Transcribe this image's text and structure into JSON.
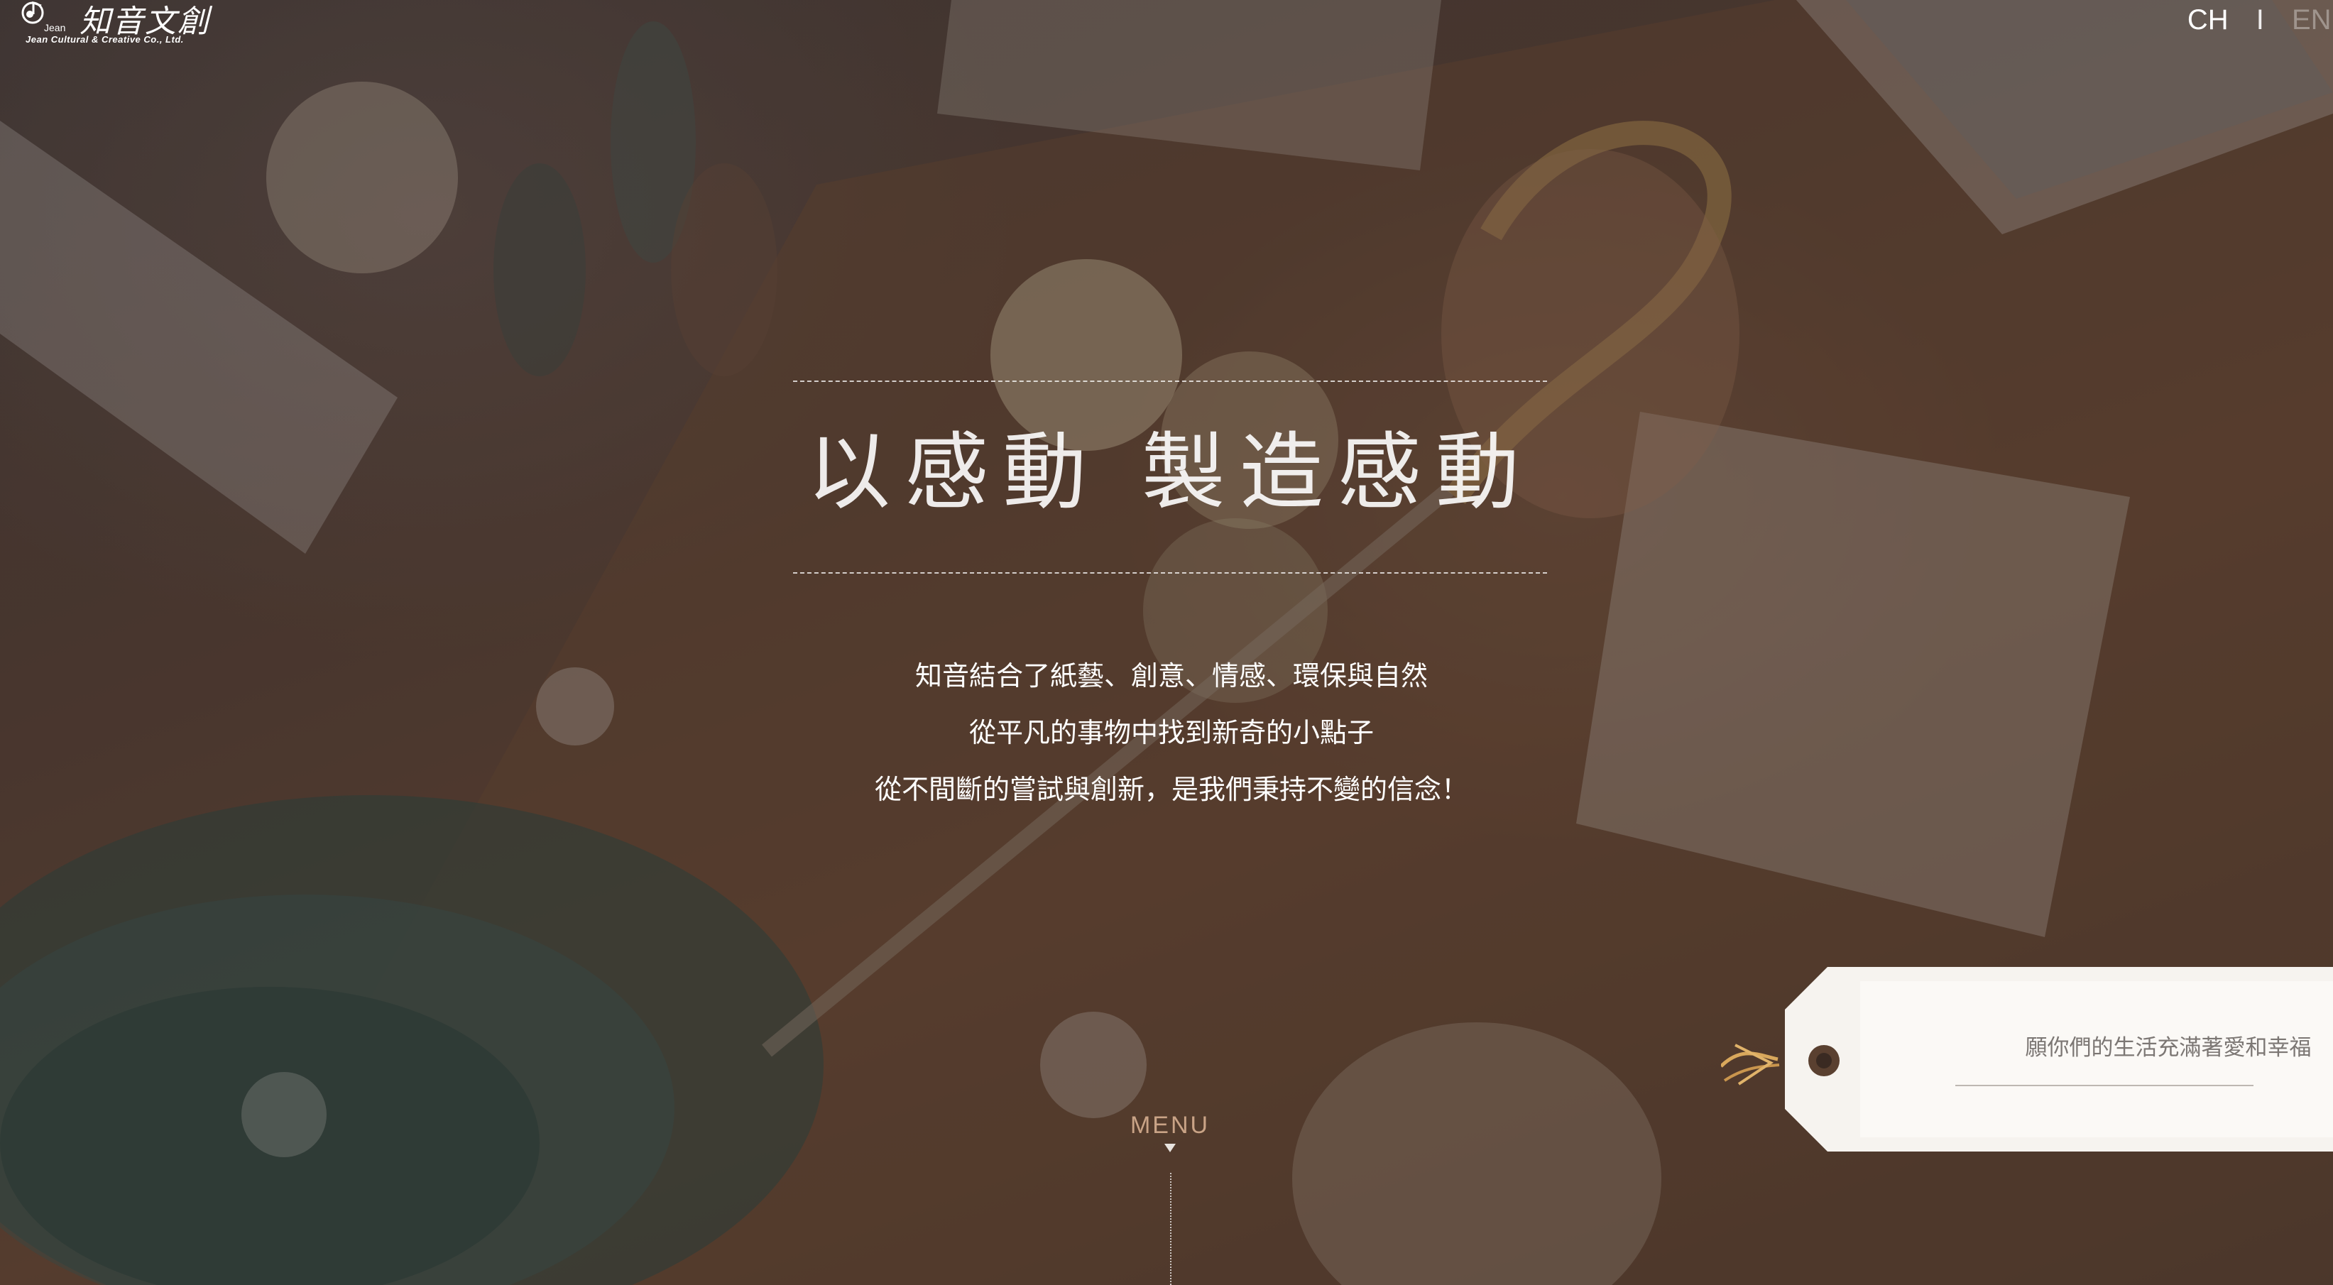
{
  "brand": {
    "title": "知音文創",
    "mark_text": "Jean",
    "subtitle": "Jean Cultural & Creative Co., Ltd."
  },
  "language": {
    "current": "CH",
    "separator": "I",
    "other": "EN"
  },
  "hero": {
    "title": "以感動 製造感動",
    "lines": [
      "知音結合了紙藝、創意、情感、環保與自然",
      "從平凡的事物中找到新奇的小點子",
      "從不間斷的嘗試與創新，是我們秉持不變的信念！"
    ]
  },
  "tag": {
    "text": "願你們的生活充滿著愛和幸福"
  },
  "menu": {
    "label": "MENU"
  },
  "colors": {
    "menu_label": "#c9a386",
    "tag_bg": "#f6f3ef",
    "tag_text": "#7c7774",
    "string": "#d9a85c"
  }
}
